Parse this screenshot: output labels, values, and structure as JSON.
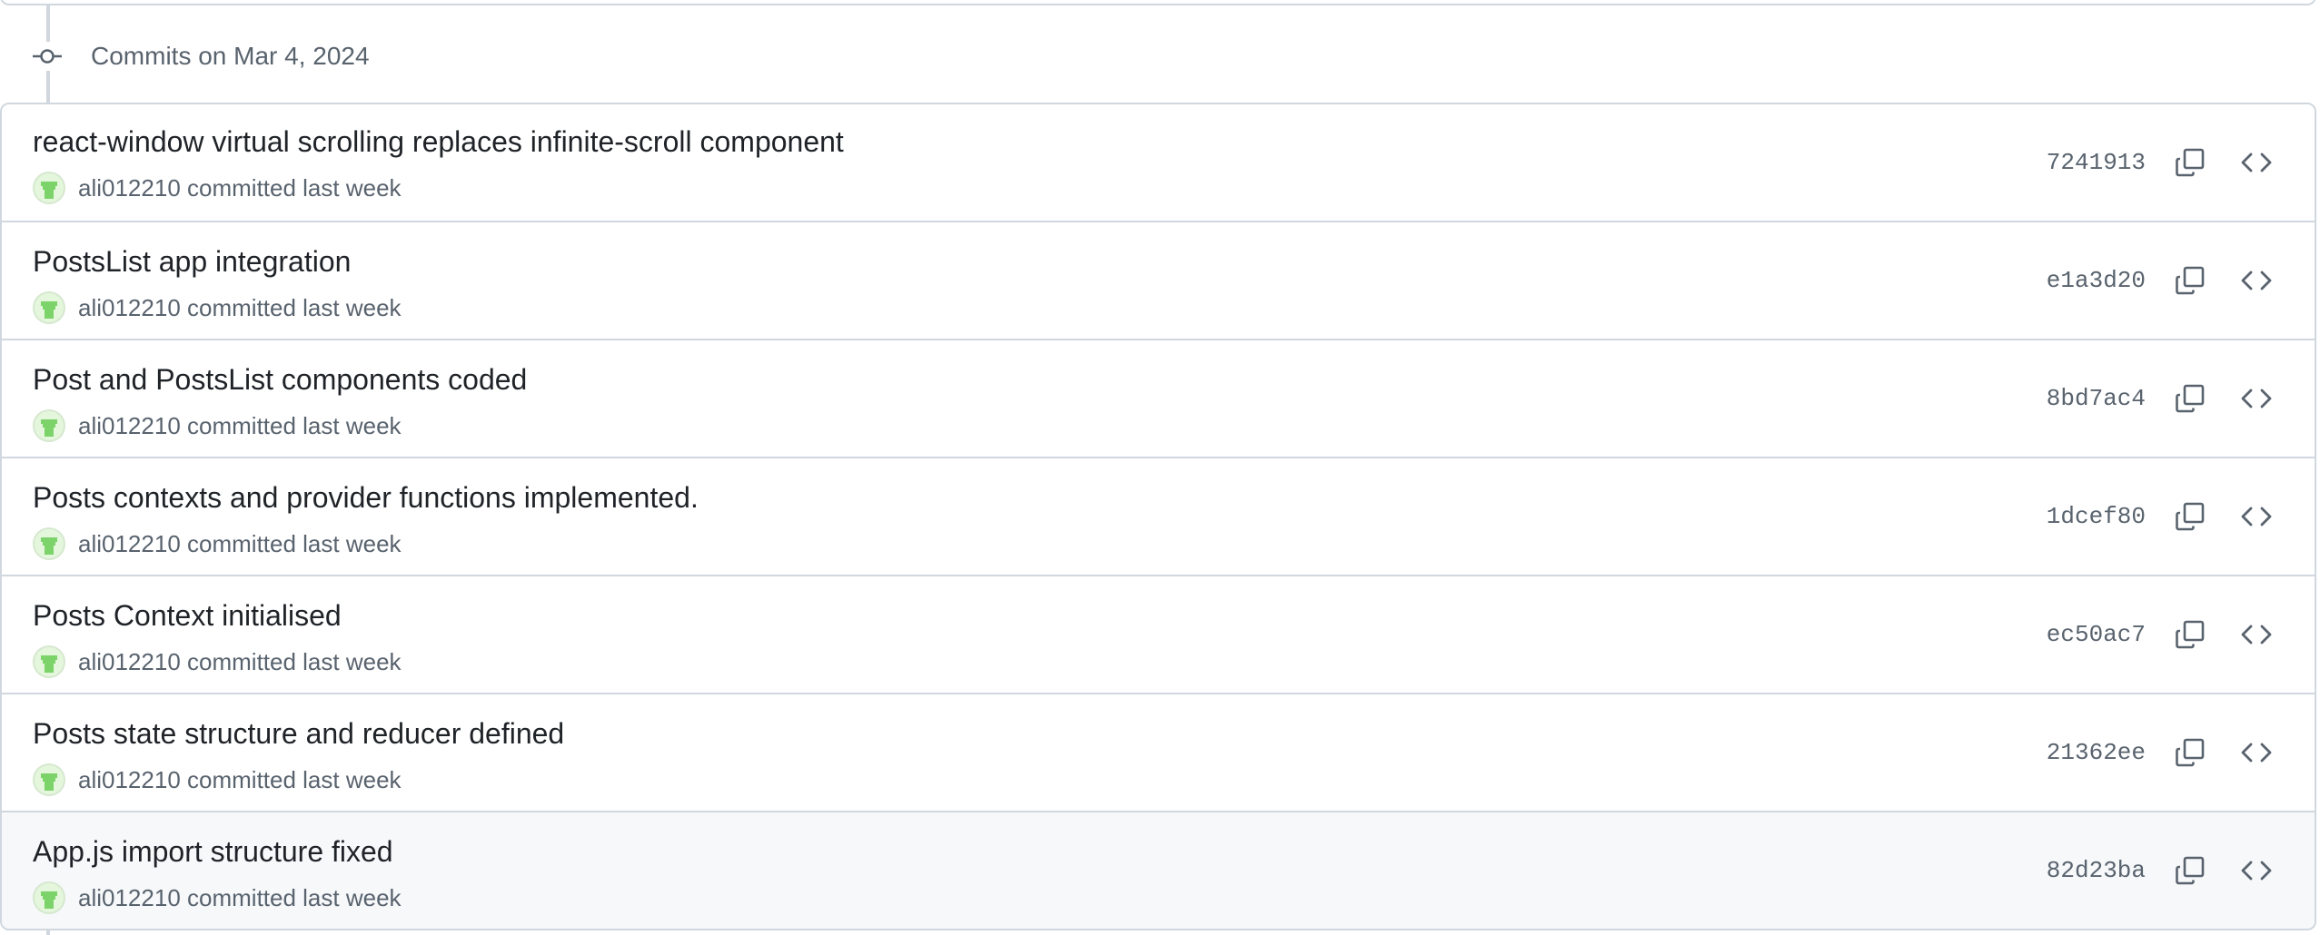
{
  "group_header": {
    "label": "Commits on Mar 4, 2024",
    "icon": "git-commit-icon"
  },
  "colors": {
    "border": "#d0d7de",
    "muted_text": "#59636e",
    "title_text": "#1f2328",
    "hover_row_bg": "#f6f8fa"
  },
  "commits": [
    {
      "title": "react-window virtual scrolling replaces infinite-scroll component",
      "author": "ali012210",
      "action": "committed last week",
      "sha": "7241913"
    },
    {
      "title": "PostsList app integration",
      "author": "ali012210",
      "action": "committed last week",
      "sha": "e1a3d20"
    },
    {
      "title": "Post and PostsList components coded",
      "author": "ali012210",
      "action": "committed last week",
      "sha": "8bd7ac4"
    },
    {
      "title": "Posts contexts and provider functions implemented.",
      "author": "ali012210",
      "action": "committed last week",
      "sha": "1dcef80"
    },
    {
      "title": "Posts Context initialised",
      "author": "ali012210",
      "action": "committed last week",
      "sha": "ec50ac7"
    },
    {
      "title": "Posts state structure and reducer defined",
      "author": "ali012210",
      "action": "committed last week",
      "sha": "21362ee"
    },
    {
      "title": "App.js import structure fixed",
      "author": "ali012210",
      "action": "committed last week",
      "sha": "82d23ba"
    }
  ]
}
